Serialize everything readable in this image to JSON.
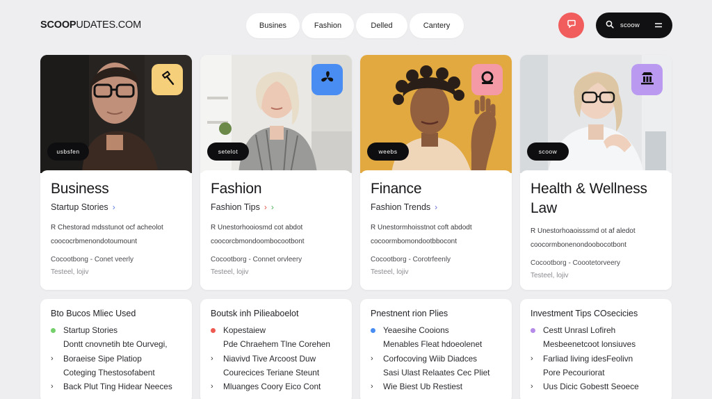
{
  "header": {
    "logo_bold": "SCOOP",
    "logo_rest": "UDATES.COM",
    "nav": [
      {
        "label": "Busines"
      },
      {
        "label": "Fashion"
      },
      {
        "label": "Delled"
      },
      {
        "label": "Cantery"
      }
    ],
    "search_label": "scoow",
    "colors": {
      "alert": "#f15c5c",
      "search_bg": "#111113"
    }
  },
  "cards": [
    {
      "chip": "usbsfen",
      "badge_color": "#f6cf7a",
      "badge_icon": "hammer-icon",
      "title": "Business",
      "title2": "",
      "sub": "Startup Stories",
      "desc1": "R Chestorad mdsstunot ocf acheolot",
      "desc2": "coococrbmenondotoumount",
      "meta1": "Cocootbong - Conet veerly",
      "meta2": "Testeel, lojiv"
    },
    {
      "chip": "setelot",
      "badge_color": "#4a8df2",
      "badge_icon": "fan-icon",
      "title": "Fashion",
      "title2": "",
      "sub": "Fashion Tips",
      "desc1": "R Unestorhooiosmd cot abdot",
      "desc2": "coocorcbmondoombocootbont",
      "meta1": "Cocootborg - Connet orvleery",
      "meta2": "Testeel, lojiv"
    },
    {
      "chip": "weebs",
      "badge_color": "#f49aa6",
      "badge_icon": "ring-icon",
      "title": "Finance",
      "title2": "",
      "sub": "Fashion Trends",
      "desc1": "R Unestormhoisstnot coft abdodt",
      "desc2": "cocoormbomondootbbocont",
      "meta1": "Cocootborg - Corotrfeenly",
      "meta2": "Testeel, lojiv"
    },
    {
      "chip": "scoow",
      "badge_color": "#b99af0",
      "badge_icon": "building-icon",
      "title": "Health & Wellness",
      "title2": "Law",
      "sub": "",
      "desc1": "R Unestorhoaoisssmd ot af aledot",
      "desc2": "coocormbonenondoobocotbont",
      "meta1": "Cocootborg - Coootetorveery",
      "meta2": "Testeel, lojiv"
    }
  ],
  "panels": [
    {
      "title": "Bto Bucos Mliec Used",
      "rows": [
        {
          "mark": "dot",
          "color": "#74d06a",
          "text": "Startup Stories"
        },
        {
          "mark": "none",
          "color": "",
          "text": "Dontt cnovnetih bte Ourvegi,"
        },
        {
          "mark": "caret",
          "color": "",
          "text": "Boraeise Sipe Platiop"
        },
        {
          "mark": "none",
          "color": "",
          "text": "Coteging Thestosofabent"
        },
        {
          "mark": "caret",
          "color": "",
          "text": "Back Plut Ting Hidear Neeces"
        }
      ]
    },
    {
      "title": "Boutsk inh Pilieaboelot",
      "rows": [
        {
          "mark": "dot",
          "color": "#ee5a52",
          "text": "Kopestaiew"
        },
        {
          "mark": "none",
          "color": "",
          "text": "Pde Chraehem Tlne Corehen"
        },
        {
          "mark": "caret",
          "color": "",
          "text": "Niavivd Tive Arcoost Duw"
        },
        {
          "mark": "none",
          "color": "",
          "text": "Courecices Teriane Steunt"
        },
        {
          "mark": "caret",
          "color": "",
          "text": "Mluanges Coory Eico Cont"
        }
      ]
    },
    {
      "title": "Pnestnent rion Plies",
      "rows": [
        {
          "mark": "dot",
          "color": "#4a8df2",
          "text": "Yeaesihe Cooions"
        },
        {
          "mark": "none",
          "color": "",
          "text": "Menables Fleat hdoeolenet"
        },
        {
          "mark": "caret",
          "color": "",
          "text": "Corfocoving Wiib Diadces"
        },
        {
          "mark": "none",
          "color": "",
          "text": "Sasi Ulast Relaates Cec Pliet"
        },
        {
          "mark": "caret",
          "color": "",
          "text": "Wie Biest Ub Restiest"
        }
      ]
    },
    {
      "title": "Investment Tips COsecicies",
      "rows": [
        {
          "mark": "dot",
          "color": "#b58ae8",
          "text": "Cestt Unrasl Lofireh"
        },
        {
          "mark": "none",
          "color": "",
          "text": "Mesbeenetcoot lonsiuves"
        },
        {
          "mark": "caret",
          "color": "",
          "text": "Farliad living idesFeolivn"
        },
        {
          "mark": "none",
          "color": "",
          "text": "Pore Pecouriorat"
        },
        {
          "mark": "caret",
          "color": "",
          "text": "Uus Dicic Gobestt Seoece"
        }
      ]
    }
  ]
}
